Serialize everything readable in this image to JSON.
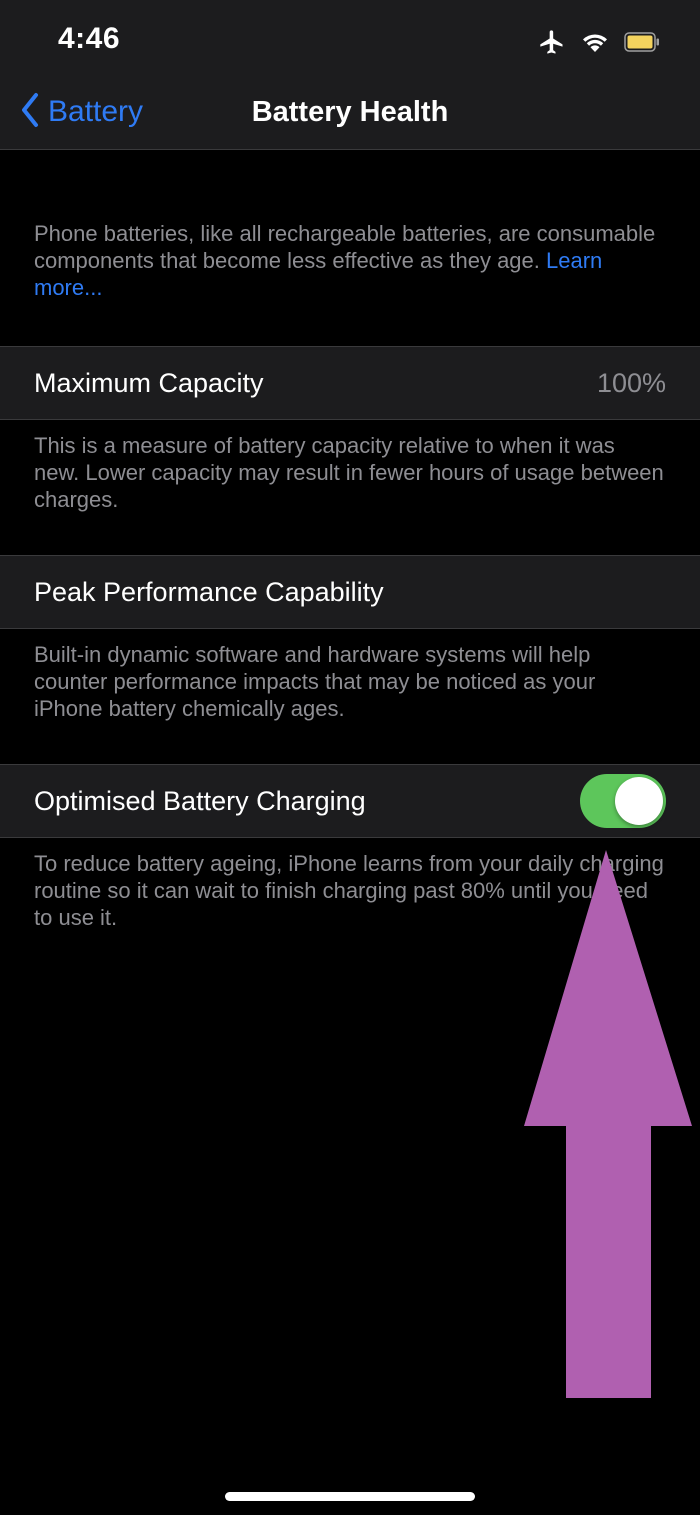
{
  "status_bar": {
    "time": "4:46",
    "icons": [
      "airplane-icon",
      "wifi-icon",
      "battery-icon"
    ],
    "battery_color": "#f4d35e"
  },
  "nav": {
    "back_label": "Battery",
    "title": "Battery Health"
  },
  "intro": {
    "text": "Phone batteries, like all rechargeable batteries, are consumable components that become less effective as they age. ",
    "link": "Learn more..."
  },
  "maximum_capacity": {
    "label": "Maximum Capacity",
    "value": "100%",
    "footnote": "This is a measure of battery capacity relative to when it was new. Lower capacity may result in fewer hours of usage between charges."
  },
  "peak_performance": {
    "label": "Peak Performance Capability",
    "footnote": "Built-in dynamic software and hardware systems will help counter performance impacts that may be noticed as your iPhone battery chemically ages."
  },
  "optimised_charging": {
    "label": "Optimised Battery Charging",
    "enabled": true,
    "footnote": "To reduce battery ageing, iPhone learns from your daily charging routine so it can wait to finish charging past 80% until you need to use it."
  },
  "colors": {
    "accent": "#2f7bf4",
    "toggle_on": "#5dc65b",
    "cell_background": "#1c1c1e",
    "secondary_text": "#8e8e93",
    "annotation_arrow": "#b060b0"
  }
}
